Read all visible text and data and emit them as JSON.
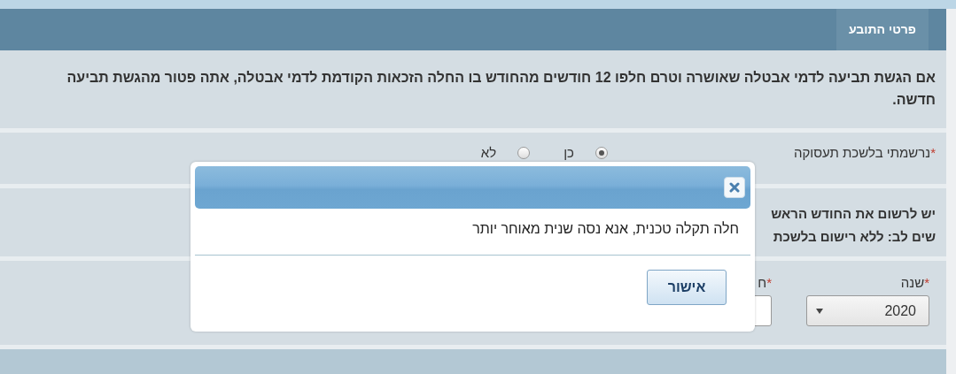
{
  "page_header": {
    "title": "פרטי התובע"
  },
  "notice": {
    "text": "אם הגשת תביעה לדמי אבטלה שאושרה וטרם חלפו 12 חודשים מהחודש בו החלה הזכאות הקודמת לדמי אבטלה, אתה פטור מהגשת תביעה חדשה."
  },
  "employment_registration": {
    "label": "נרשמתי בלשכת תעסוקה",
    "required_mark": "*",
    "options": [
      {
        "label": "כן",
        "selected": true
      },
      {
        "label": "לא",
        "selected": false
      }
    ]
  },
  "instructions": {
    "lines": [
      "יש לרשום את החודש הראש",
      "שים לב: ללא רישום בלשכת"
    ]
  },
  "date_fields": [
    {
      "kind": "select",
      "label": "שנה",
      "required_mark": "*",
      "value": "2020"
    },
    {
      "kind": "input",
      "label": "ח",
      "required_mark": "*"
    }
  ],
  "dialog": {
    "message": "חלה תקלה טכנית, אנא נסה שנית מאוחר יותר",
    "buttons": [
      "אישור"
    ]
  }
}
